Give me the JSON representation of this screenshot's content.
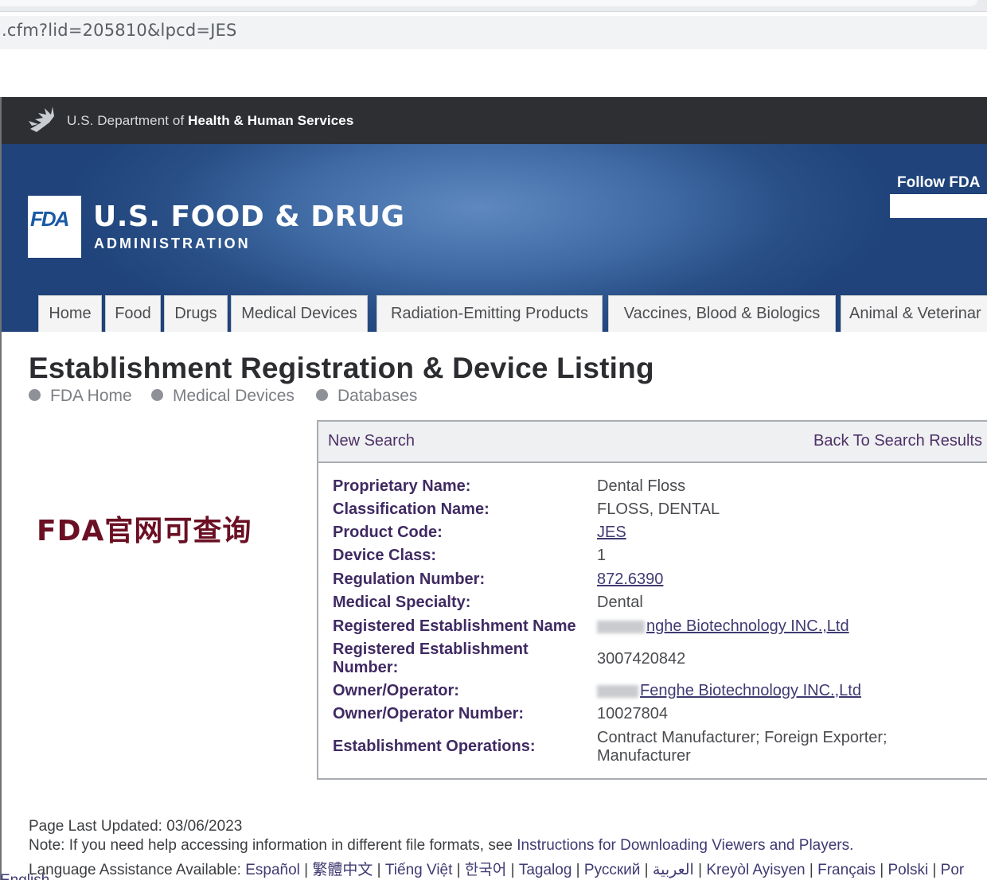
{
  "browser": {
    "url_fragment": ".cfm?lid=205810&lpcd=JES"
  },
  "hhs": {
    "prefix": "U.S. Department of ",
    "bold": "Health & Human Services"
  },
  "header": {
    "logo_text": "FDA",
    "title": "U.S. FOOD & DRUG",
    "subtitle": "ADMINISTRATION",
    "follow_label": "Follow FDA"
  },
  "nav": {
    "tabs": [
      {
        "label": "Home"
      },
      {
        "label": "Food"
      },
      {
        "label": "Drugs"
      },
      {
        "label": "Medical Devices"
      },
      {
        "label": "Radiation-Emitting Products"
      },
      {
        "label": "Vaccines, Blood & Biologics"
      },
      {
        "label": "Animal & Veterinar"
      }
    ]
  },
  "page": {
    "title": "Establishment Registration & Device Listing",
    "breadcrumbs": [
      "FDA Home",
      "Medical Devices",
      "Databases"
    ]
  },
  "annotation": {
    "text": "FDA官网可查询"
  },
  "panel": {
    "new_search": "New Search",
    "back_to_results": "Back To Search Results",
    "fields": [
      {
        "label": "Proprietary Name:",
        "value": "Dental Floss"
      },
      {
        "label": "Classification Name:",
        "value": "FLOSS, DENTAL"
      },
      {
        "label": "Product Code:",
        "value": "JES"
      },
      {
        "label": "Device Class:",
        "value": "1"
      },
      {
        "label": "Regulation Number:",
        "value": "872.6390"
      },
      {
        "label": "Medical Specialty:",
        "value": "Dental"
      },
      {
        "label": "Registered Establishment Name",
        "value": "nghe Biotechnology INC.,Ltd"
      },
      {
        "label": "Registered Establishment Number:",
        "value": "3007420842"
      },
      {
        "label": "Owner/Operator:",
        "value": "Fenghe Biotechnology INC.,Ltd"
      },
      {
        "label": "Owner/Operator Number:",
        "value": "10027804"
      },
      {
        "label": "Establishment Operations:",
        "value": "Contract Manufacturer; Foreign Exporter; Manufacturer"
      }
    ]
  },
  "footer": {
    "updated": "Page Last Updated: 03/06/2023",
    "note_prefix": "Note: If you need help accessing information in different file formats, see ",
    "note_link": "Instructions for Downloading Viewers and Players.",
    "lang_prefix": "Language Assistance Available: ",
    "languages": [
      "Español",
      "繁體中文",
      "Tiếng Việt",
      "한국어",
      "Tagalog",
      "Русский",
      "العربية",
      "Kreyòl Ayisyen",
      "Français",
      "Polski",
      "Por"
    ],
    "next_line": "English"
  }
}
